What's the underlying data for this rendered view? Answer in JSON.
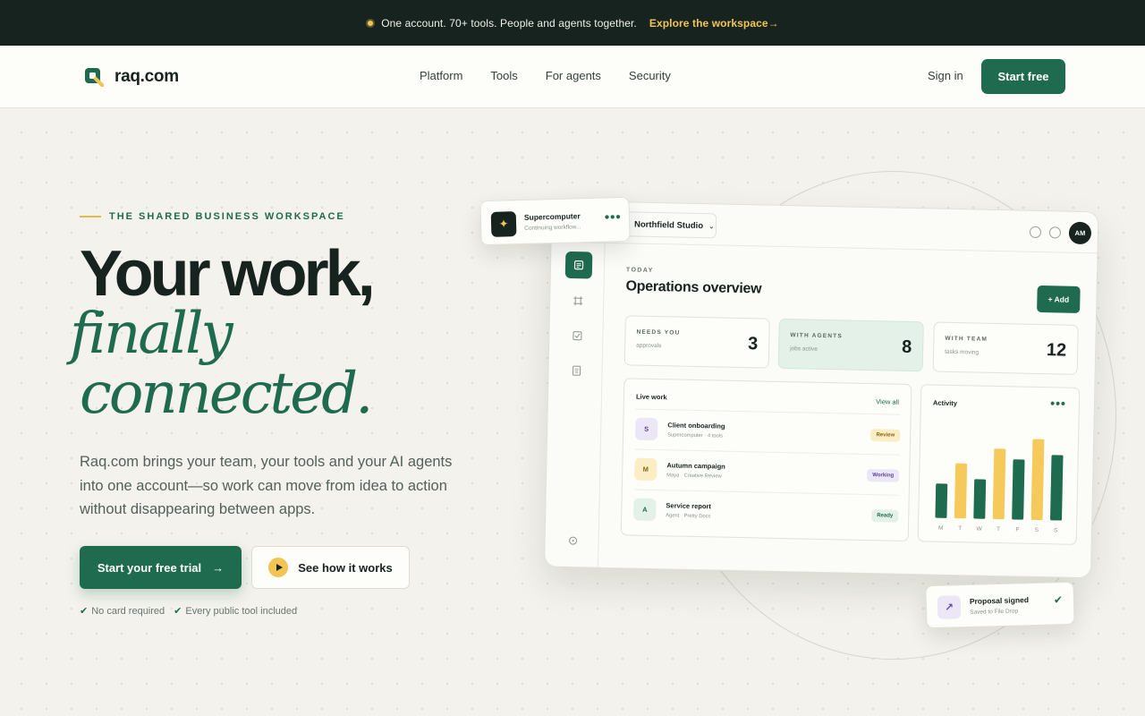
{
  "announcement": {
    "text": "One account. 70+ tools. People and agents together.",
    "link": "Explore the workspace→"
  },
  "nav": {
    "brand": "raq.com",
    "links": [
      "Platform",
      "Tools",
      "For agents",
      "Security"
    ],
    "sign_in": "Sign in",
    "start_free": "Start free"
  },
  "hero": {
    "eyebrow": "THE SHARED BUSINESS WORKSPACE",
    "headline": "Your work,",
    "headline_italic_1": "finally",
    "headline_italic_2": "connected.",
    "lede": "Raq.com brings your team, your tools and your AI agents into one account—so work can move from idea to action without disappearing between apps.",
    "cta_primary": "Start your free trial",
    "cta_primary_arrow": "→",
    "cta_secondary": "See how it works",
    "checks": [
      "No card required",
      "Every public tool included"
    ]
  },
  "mockup": {
    "workspace": "Northfield Studio",
    "avatar": "AM",
    "eyebrow": "TODAY",
    "title": "Operations overview",
    "add_button": "+ Add",
    "stats": [
      {
        "label": "NEEDS YOU",
        "sub": "approvals",
        "value": "3"
      },
      {
        "label": "WITH AGENTS",
        "sub": "jobs active",
        "value": "8"
      },
      {
        "label": "WITH TEAM",
        "sub": "tasks moving",
        "value": "12"
      }
    ],
    "live_work": {
      "title": "Live work",
      "view_all": "View all",
      "rows": [
        {
          "initial": "S",
          "title": "Client onboarding",
          "sub": "Supercomputer · 4 tools",
          "badge": "Review"
        },
        {
          "initial": "M",
          "title": "Autumn campaign",
          "sub": "Maya · Creative Review",
          "badge": "Working"
        },
        {
          "initial": "A",
          "title": "Service report",
          "sub": "Agent · Pretty Docs",
          "badge": "Ready"
        }
      ]
    },
    "activity": {
      "title": "Activity",
      "more": "•••"
    }
  },
  "float_supercomputer": {
    "title": "Supercomputer",
    "sub": "Continuing workflow...",
    "more": "•••"
  },
  "float_proposal": {
    "title": "Proposal signed",
    "sub": "Saved to File Drop"
  },
  "chart_data": {
    "type": "bar",
    "title": "Activity",
    "categories": [
      "M",
      "T",
      "W",
      "T",
      "F",
      "S",
      "S"
    ],
    "values": [
      40,
      64,
      46,
      82,
      70,
      94,
      76
    ],
    "colors": [
      "#1f6b4f",
      "#f5c95a",
      "#1f6b4f",
      "#f5c95a",
      "#1f6b4f",
      "#f5c95a",
      "#1f6b4f"
    ],
    "ylim": [
      0,
      100
    ],
    "grid": false
  },
  "colors": {
    "brand": "#1f6b4f",
    "accent": "#f1c453",
    "dark": "#17231e",
    "background": "#f3f2ec"
  }
}
